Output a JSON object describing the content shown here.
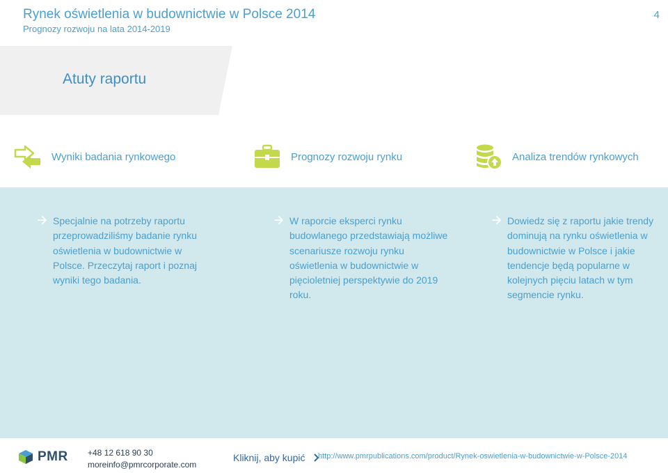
{
  "header": {
    "title": "Rynek oświetlenia w budownictwie w Polsce 2014",
    "subtitle": "Prognozy rozwoju na lata 2014-2019",
    "page_number": "4"
  },
  "banner": {
    "title": "Atuty raportu"
  },
  "features": [
    {
      "icon": "arrows-exchange-icon",
      "label": "Wyniki badania rynkowego"
    },
    {
      "icon": "briefcase-icon",
      "label": "Prognozy rozwoju rynku"
    },
    {
      "icon": "database-upload-icon",
      "label": "Analiza trendów rynkowych"
    }
  ],
  "columns": [
    {
      "text": "Specjalnie na potrzeby raportu przeprowadziliśmy badanie rynku oświetlenia w budownictwie w Polsce. Przeczytaj raport i poznaj wyniki tego badania."
    },
    {
      "text": "W raporcie eksperci rynku budowlanego przedstawiają możliwe scenariusze rozwoju rynku oświetlenia w budownictwie w pięcioletniej perspektywie do 2019 roku."
    },
    {
      "text": "Dowiedz się z raportu jakie trendy dominują na rynku oświetlenia w budownictwie w Polsce i jakie tendencje będą popularne w kolejnych pięciu latach w tym segmencie rynku."
    }
  ],
  "footer": {
    "logo_text": "PMR",
    "phone": "+48 12 618 90 30",
    "email": "moreinfo@pmrcorporate.com",
    "buy_label": "Kliknij, aby kupić",
    "url": "http://www.pmrpublications.com/product/Rynek-oswietlenia-w-budownictwie-w-Polsce-2014"
  },
  "colors": {
    "accent": "#4a9fcf",
    "icon_green": "#c3d84a",
    "content_bg": "#d1e8ec",
    "banner_bg": "#f0f0f0"
  }
}
